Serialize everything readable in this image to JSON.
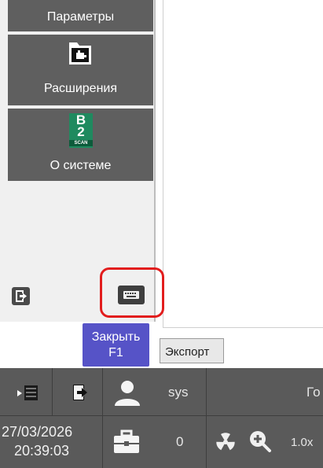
{
  "sidebar": {
    "params_label": "Параметры",
    "extensions_label": "Расширения",
    "about_label": "О системе",
    "about_logo_top": "B",
    "about_logo_mid": "2",
    "about_logo_bottom": "SCAN"
  },
  "close_button": {
    "line1": "Закрыть",
    "line2": "F1"
  },
  "export_tab": {
    "label": "Экспорт"
  },
  "status": {
    "user": "sys",
    "date": "27/03/2026",
    "time": "20:39:03",
    "count": "0",
    "zoom": "1.0x",
    "right_text": "Го"
  },
  "colors": {
    "sidebar_button": "#5f5f5f",
    "close_button": "#5653c7",
    "highlight": "#e21d1d",
    "status_bar": "#5a5a5a",
    "logo_green": "#1f8a5f"
  },
  "icons": [
    "folder-icon",
    "b2scan-logo",
    "exit-icon",
    "keyboard-icon",
    "panel-icon",
    "user-icon",
    "briefcase-icon",
    "radiation-icon",
    "zoom-in-icon"
  ]
}
